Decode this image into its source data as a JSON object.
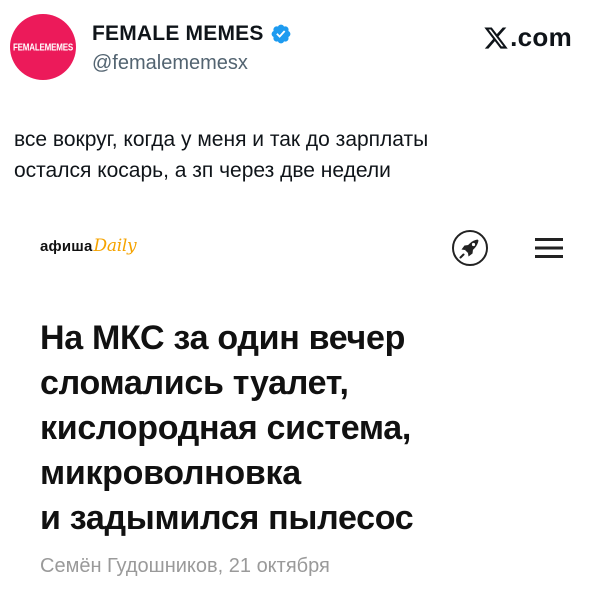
{
  "account": {
    "avatar_text": "FEMALEMEMES",
    "display_name": "FEMALE MEMES",
    "handle": "@femalememesx",
    "verified_icon": "verified-badge-icon",
    "avatar_color": "#ec1a5a",
    "verified_color": "#1d9bf0"
  },
  "brand": {
    "label": ".com",
    "icon": "x-logo-icon"
  },
  "tweet": {
    "lines": [
      "все вокруг, когда у меня и так до зарплаты",
      "остался косарь, а зп через две недели"
    ]
  },
  "media": {
    "site_logo": {
      "primary": "афиша",
      "secondary": "Daily",
      "secondary_color": "#f5a300"
    },
    "icons": [
      "rocket-icon",
      "menu-icon"
    ],
    "headline_lines": [
      "На МКС за один вечер",
      "сломались туалет,",
      "кислородная система,",
      "микроволновка",
      "и задымился пылесос"
    ],
    "byline": "Семён Гудошников, 21 октября"
  }
}
